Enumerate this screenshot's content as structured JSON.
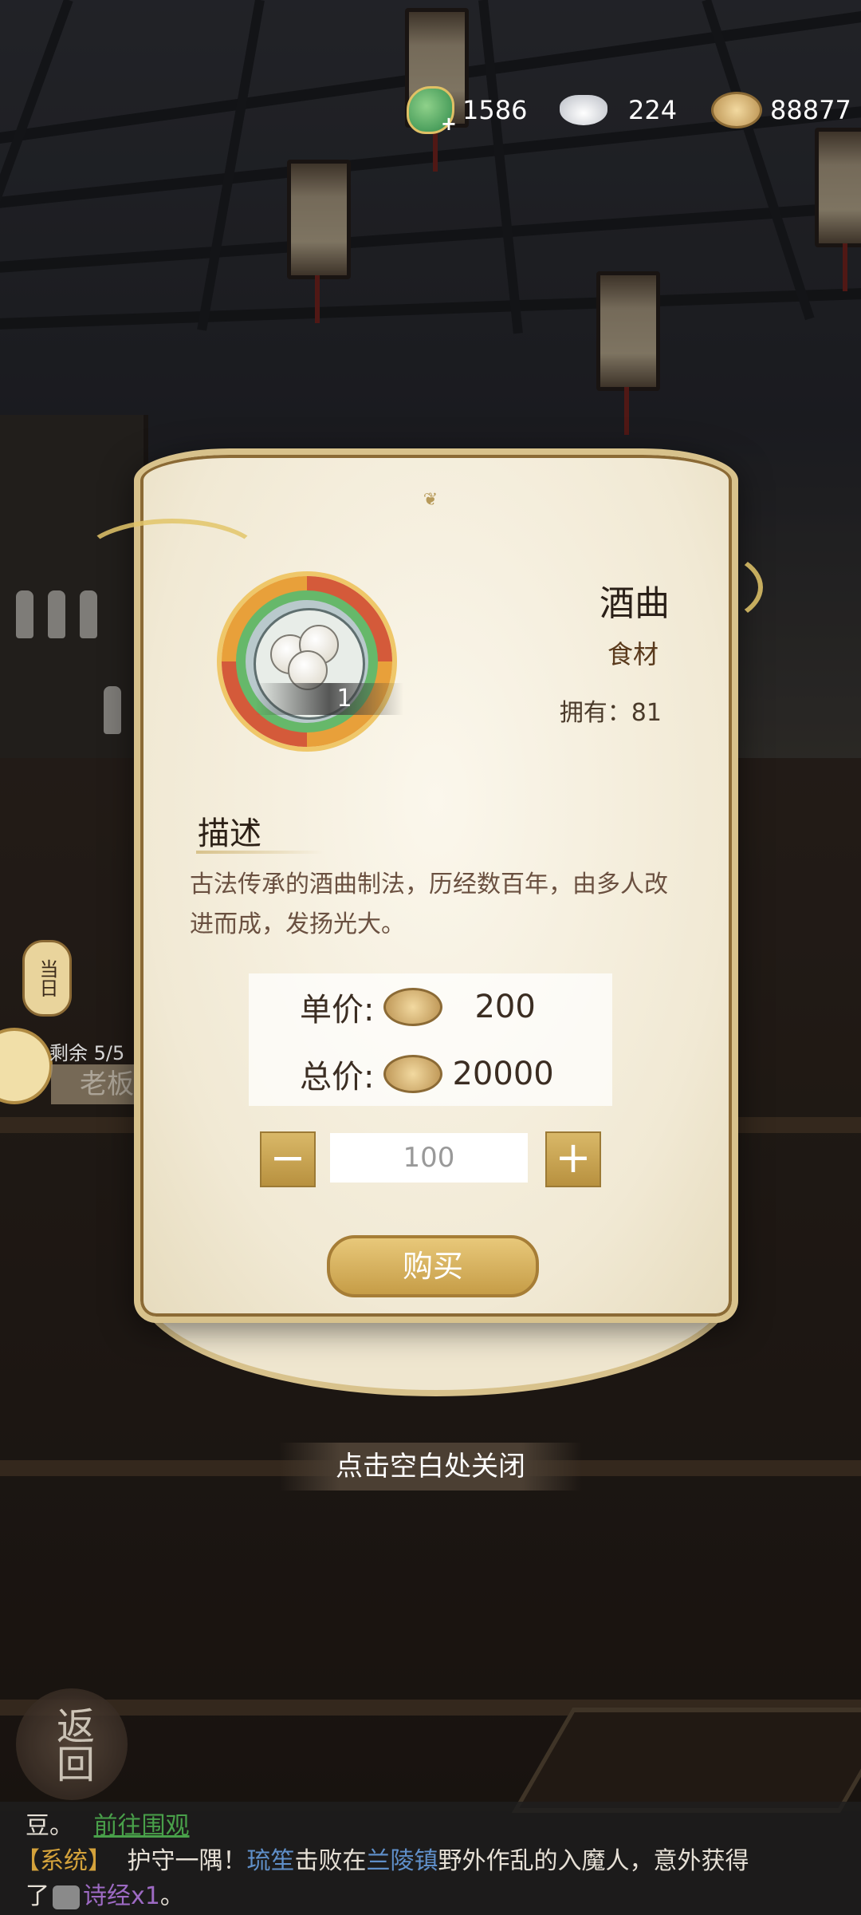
{
  "resources": {
    "jade": "1586",
    "silver": "224",
    "copper": "88877"
  },
  "side": {
    "today_tag": "当日",
    "remaining": "剩余 5/5",
    "shop_name": "老板"
  },
  "item": {
    "name": "酒曲",
    "type": "食材",
    "count": "1",
    "owned_label": "拥有：81"
  },
  "description": {
    "title": "描述",
    "text": "古法传承的酒曲制法，历经数百年，由多人改进而成，发扬光大。"
  },
  "pricing": {
    "unit_label": "单价:",
    "unit_value": "200",
    "total_label": "总价:",
    "total_value": "20000"
  },
  "quantity": {
    "minus": "−",
    "value": "100",
    "plus": "+"
  },
  "buy_label": "购买",
  "close_hint": "点击空白处关闭",
  "return_label": "返回",
  "chat": {
    "line1_text": "豆。",
    "line1_link": "前往围观",
    "line2_tag": "【系统】",
    "line2_a": "护守一隅！",
    "line2_name": "琉笙",
    "line2_b": "击败在",
    "line2_place": "兰陵镇",
    "line2_c": "野外作乱的入魔人，意外获得",
    "line3_a": "了",
    "line3_item": "诗经x1",
    "line3_b": "。"
  },
  "colors": {
    "gold": "#c69d47",
    "panel": "#f1e9d4",
    "link_green": "#49a04a",
    "system_gold": "#d4a23b",
    "name_blue": "#5f8fc9",
    "item_purple": "#9d6ac3"
  }
}
